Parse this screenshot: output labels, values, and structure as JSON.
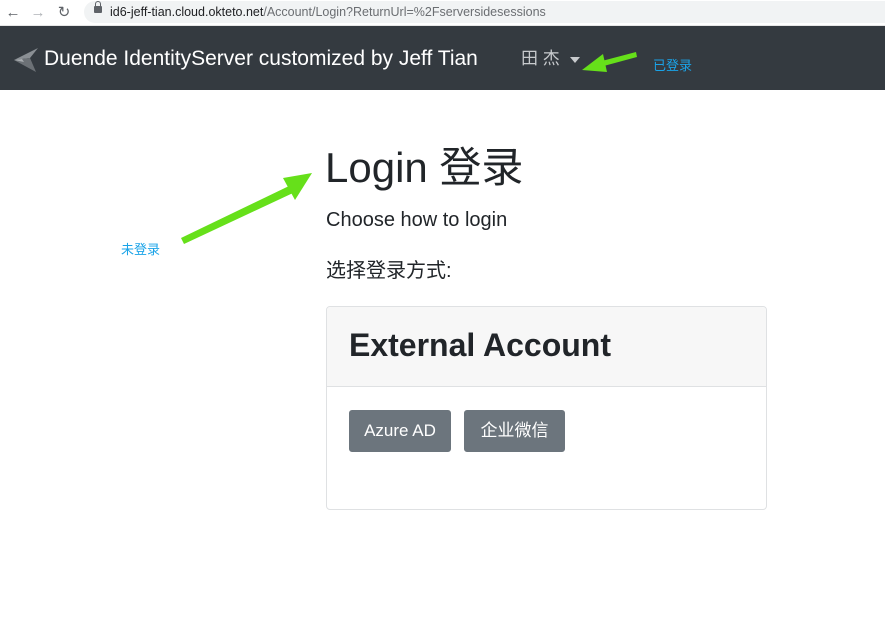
{
  "browser": {
    "url_host": "id6-jeff-tian.cloud.okteto.net",
    "url_path": "/Account/Login?ReturnUrl=%2Fserversidesessions",
    "back_icon": "arrow-left-icon",
    "forward_icon": "arrow-right-icon",
    "reload_icon": "reload-icon",
    "lock_icon": "lock-icon"
  },
  "navbar": {
    "brand": "Duende IdentityServer customized by Jeff Tian",
    "user_name": "田 杰",
    "background": "#343a40"
  },
  "annotations": {
    "logged_in": "已登录",
    "not_logged_in": "未登录",
    "arrow_color": "#66e01a",
    "text_color": "#1aa3e8"
  },
  "main": {
    "title": "Login 登录",
    "lead": "Choose how to login",
    "choose_label": "选择登录方式:"
  },
  "external": {
    "title": "External Account",
    "providers": [
      "Azure AD",
      "企业微信"
    ],
    "button_color": "#6c757d"
  }
}
